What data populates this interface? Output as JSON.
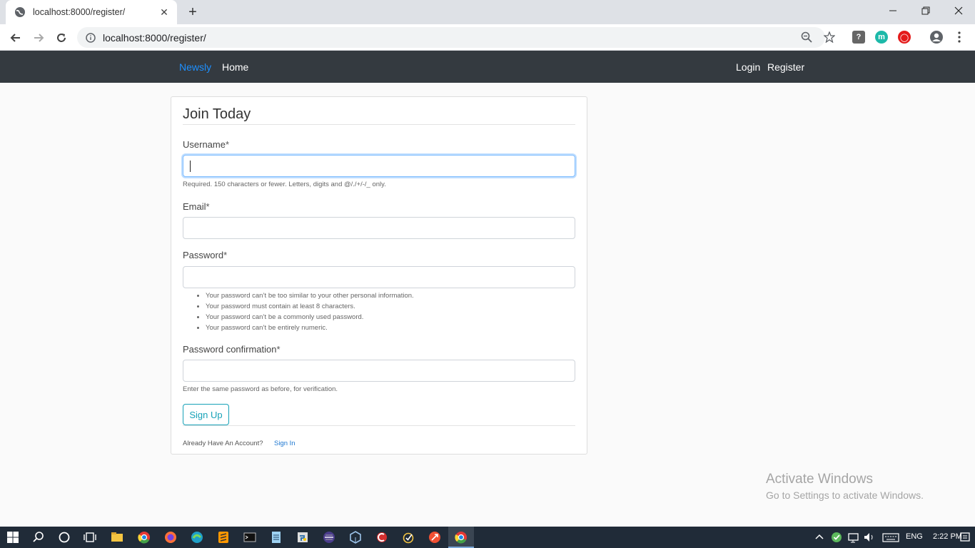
{
  "browser": {
    "tab_title": "localhost:8000/register/",
    "url": "localhost:8000/register/",
    "newtab_symbol": "+",
    "close_symbol": "✕"
  },
  "navbar": {
    "brand": "Newsly",
    "home": "Home",
    "login": "Login",
    "register": "Register"
  },
  "form": {
    "legend": "Join Today",
    "username_label": "Username",
    "username_help": "Required. 150 characters or fewer. Letters, digits and @/./+/-/_ only.",
    "email_label": "Email",
    "password_label": "Password",
    "password_rules": [
      "Your password can’t be too similar to your other personal information.",
      "Your password must contain at least 8 characters.",
      "Your password can’t be a commonly used password.",
      "Your password can’t be entirely numeric."
    ],
    "password2_label": "Password confirmation",
    "password2_help": "Enter the same password as before, for verification.",
    "required_mark": "*",
    "submit_label": "Sign Up",
    "footer_text": "Already Have An Account?",
    "signin_label": "Sign In"
  },
  "watermark": {
    "line1": "Activate Windows",
    "line2": "Go to Settings to activate Windows."
  },
  "taskbar": {
    "language": "ENG",
    "time": "2:22 PM"
  },
  "colors": {
    "navbar_bg": "#343a40",
    "brand": "#1e90ff",
    "button_accent": "#17a2b8"
  }
}
